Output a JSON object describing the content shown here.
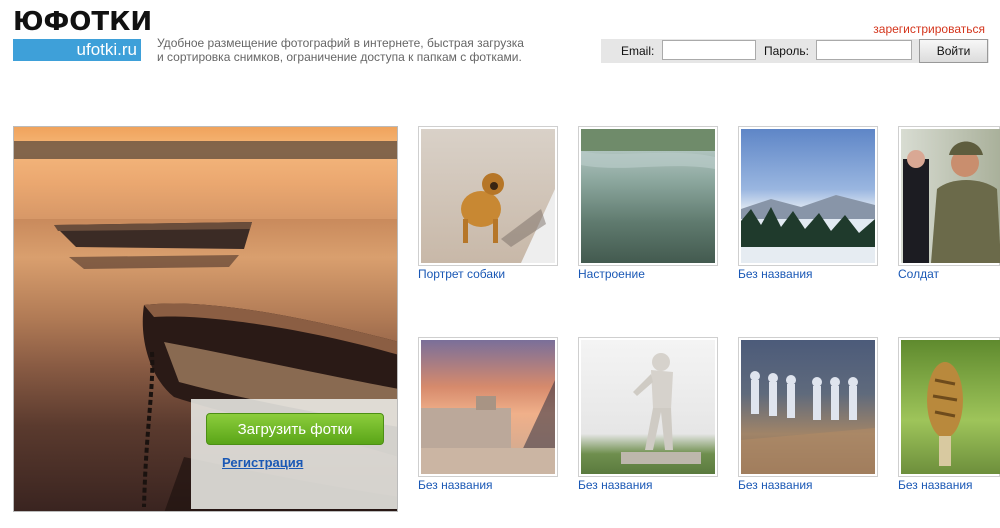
{
  "header": {
    "logo_top": "ЮФОТКИ",
    "logo_domain": "ufotki.ru",
    "tagline": [
      "Удобное размещение фотографий в интернете, быстрая загрузка",
      "и сортировка снимков, ограничение доступа к папкам с фотками."
    ],
    "register_link": "зарегистрироваться",
    "login": {
      "email_label": "Email:",
      "email_value": "",
      "password_label": "Пароль:",
      "password_value": "",
      "submit_label": "Войти"
    }
  },
  "hero": {
    "upload_label": "Загрузить фотки",
    "register_label": "Регистрация"
  },
  "gallery": [
    {
      "caption": "Портрет собаки",
      "theme": "dog"
    },
    {
      "caption": "Настроение",
      "theme": "lake"
    },
    {
      "caption": "Без названия",
      "theme": "mountains"
    },
    {
      "caption": "Солдат",
      "theme": "soldier"
    },
    {
      "caption": "Без названия",
      "theme": "louvre"
    },
    {
      "caption": "Без названия",
      "theme": "statue"
    },
    {
      "caption": "Без названия",
      "theme": "chess"
    },
    {
      "caption": "Без названия",
      "theme": "mushroom"
    }
  ],
  "colors": {
    "accent_blue": "#3ea0d9",
    "link_blue": "#1a58b5",
    "register_red": "#d4351c",
    "upload_green": "#6ab628"
  }
}
